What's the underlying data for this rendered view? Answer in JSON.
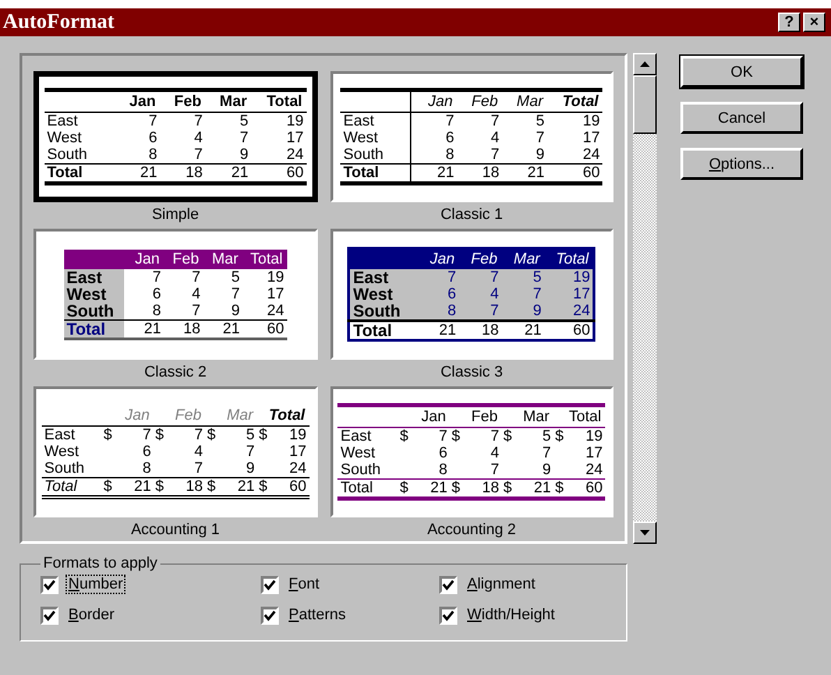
{
  "window": {
    "title": "AutoFormat",
    "help": "?",
    "close": "×"
  },
  "samples": [
    {
      "name": "Simple",
      "kind": "simple",
      "selected": true,
      "table": {
        "columns": [
          "Jan",
          "Feb",
          "Mar",
          "Total"
        ],
        "rows": [
          {
            "label": "East",
            "cells": [
              "7",
              "7",
              "5",
              "19"
            ]
          },
          {
            "label": "West",
            "cells": [
              "6",
              "4",
              "7",
              "17"
            ]
          },
          {
            "label": "South",
            "cells": [
              "8",
              "7",
              "9",
              "24"
            ]
          },
          {
            "label": "Total",
            "cells": [
              "21",
              "18",
              "21",
              "60"
            ]
          }
        ]
      }
    },
    {
      "name": "Classic 1",
      "kind": "classic1",
      "selected": false,
      "table": {
        "columns": [
          "Jan",
          "Feb",
          "Mar",
          "Total"
        ],
        "rows": [
          {
            "label": "East",
            "cells": [
              "7",
              "7",
              "5",
              "19"
            ]
          },
          {
            "label": "West",
            "cells": [
              "6",
              "4",
              "7",
              "17"
            ]
          },
          {
            "label": "South",
            "cells": [
              "8",
              "7",
              "9",
              "24"
            ]
          },
          {
            "label": "Total",
            "cells": [
              "21",
              "18",
              "21",
              "60"
            ]
          }
        ]
      }
    },
    {
      "name": "Classic 2",
      "kind": "classic2",
      "selected": false,
      "table": {
        "columns": [
          "Jan",
          "Feb",
          "Mar",
          "Total"
        ],
        "rows": [
          {
            "label": "East",
            "cells": [
              "7",
              "7",
              "5",
              "19"
            ]
          },
          {
            "label": "West",
            "cells": [
              "6",
              "4",
              "7",
              "17"
            ]
          },
          {
            "label": "South",
            "cells": [
              "8",
              "7",
              "9",
              "24"
            ]
          },
          {
            "label": "Total",
            "cells": [
              "21",
              "18",
              "21",
              "60"
            ]
          }
        ]
      }
    },
    {
      "name": "Classic 3",
      "kind": "classic3",
      "selected": false,
      "table": {
        "columns": [
          "Jan",
          "Feb",
          "Mar",
          "Total"
        ],
        "rows": [
          {
            "label": "East",
            "cells": [
              "7",
              "7",
              "5",
              "19"
            ]
          },
          {
            "label": "West",
            "cells": [
              "6",
              "4",
              "7",
              "17"
            ]
          },
          {
            "label": "South",
            "cells": [
              "8",
              "7",
              "9",
              "24"
            ]
          },
          {
            "label": "Total",
            "cells": [
              "21",
              "18",
              "21",
              "60"
            ]
          }
        ]
      }
    },
    {
      "name": "Accounting 1",
      "kind": "accounting1",
      "selected": false,
      "table": {
        "columns": [
          "Jan",
          "Feb",
          "Mar",
          "Total"
        ],
        "rows": [
          {
            "label": "East",
            "cells": [
              "7",
              "7",
              "5",
              "19"
            ],
            "currency": [
              "$",
              "$",
              "$",
              "$"
            ]
          },
          {
            "label": "West",
            "cells": [
              "6",
              "4",
              "7",
              "17"
            ]
          },
          {
            "label": "South",
            "cells": [
              "8",
              "7",
              "9",
              "24"
            ]
          },
          {
            "label": "Total",
            "cells": [
              "21",
              "18",
              "21",
              "60"
            ],
            "currency": [
              "$",
              "$",
              "$",
              "$"
            ]
          }
        ]
      }
    },
    {
      "name": "Accounting 2",
      "kind": "accounting2",
      "selected": false,
      "table": {
        "columns": [
          "Jan",
          "Feb",
          "Mar",
          "Total"
        ],
        "rows": [
          {
            "label": "East",
            "cells": [
              "7",
              "7",
              "5",
              "19"
            ],
            "currency": [
              "$",
              "$",
              "$",
              "$"
            ]
          },
          {
            "label": "West",
            "cells": [
              "6",
              "4",
              "7",
              "17"
            ]
          },
          {
            "label": "South",
            "cells": [
              "8",
              "7",
              "9",
              "24"
            ]
          },
          {
            "label": "Total",
            "cells": [
              "21",
              "18",
              "21",
              "60"
            ],
            "currency": [
              "$",
              "$",
              "$",
              "$"
            ]
          }
        ]
      }
    }
  ],
  "buttons": [
    {
      "label": "OK",
      "kind": "default"
    },
    {
      "label": "Cancel",
      "kind": "plain"
    },
    {
      "label": "Options...",
      "kind": "mnemonic"
    }
  ],
  "formats": {
    "title": "Formats to apply",
    "options": [
      {
        "label": "Number",
        "checked": true,
        "focused": true
      },
      {
        "label": "Font",
        "checked": true,
        "focused": false
      },
      {
        "label": "Alignment",
        "checked": true,
        "focused": false
      },
      {
        "label": "Border",
        "checked": true,
        "focused": false
      },
      {
        "label": "Patterns",
        "checked": true,
        "focused": false
      },
      {
        "label": "Width/Height",
        "checked": true,
        "focused": false
      }
    ]
  }
}
